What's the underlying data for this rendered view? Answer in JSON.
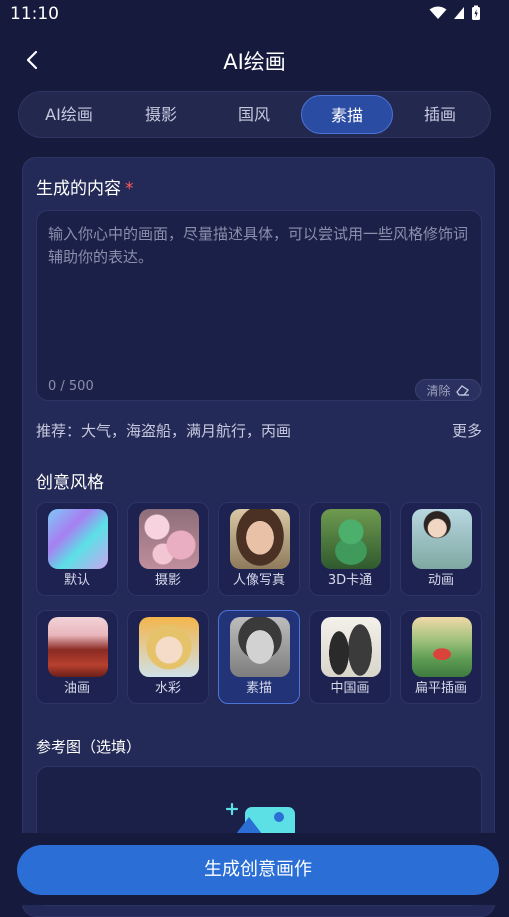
{
  "status": {
    "time": "11:10"
  },
  "header": {
    "title": "AI绘画"
  },
  "tabs": [
    {
      "label": "AI绘画"
    },
    {
      "label": "摄影"
    },
    {
      "label": "国风"
    },
    {
      "label": "素描",
      "active": true
    },
    {
      "label": "插画"
    }
  ],
  "content": {
    "title": "生成的内容",
    "required_mark": "*",
    "placeholder": "输入你心中的画面，尽量描述具体，可以尝试用一些风格修饰词辅助你的表达。",
    "counter": "0 / 500",
    "clear_label": "清除"
  },
  "suggest": {
    "prefix": "推荐：",
    "text": "大气，海盗船，满月航行，丙画",
    "more": "更多"
  },
  "styles": {
    "title": "创意风格",
    "items": [
      {
        "label": "默认",
        "icon": "holographic-gradient"
      },
      {
        "label": "摄影",
        "icon": "cherry-blossom-photo"
      },
      {
        "label": "人像写真",
        "icon": "portrait-photo"
      },
      {
        "label": "3D卡通",
        "icon": "3d-dinosaur"
      },
      {
        "label": "动画",
        "icon": "anime-girl"
      },
      {
        "label": "油画",
        "icon": "oil-painting-pagoda"
      },
      {
        "label": "水彩",
        "icon": "watercolor-girl"
      },
      {
        "label": "素描",
        "icon": "sketch-portrait",
        "active": true
      },
      {
        "label": "中国画",
        "icon": "ink-landscape"
      },
      {
        "label": "扁平插画",
        "icon": "flat-landscape"
      }
    ]
  },
  "reference": {
    "title": "参考图（选填）",
    "icon": "add-image-icon"
  },
  "action": {
    "generate_label": "生成创意画作"
  },
  "colors": {
    "accent": "#2b6ed6",
    "background": "#161a3d",
    "card": "#242a57",
    "required": "#ff5b5b"
  }
}
